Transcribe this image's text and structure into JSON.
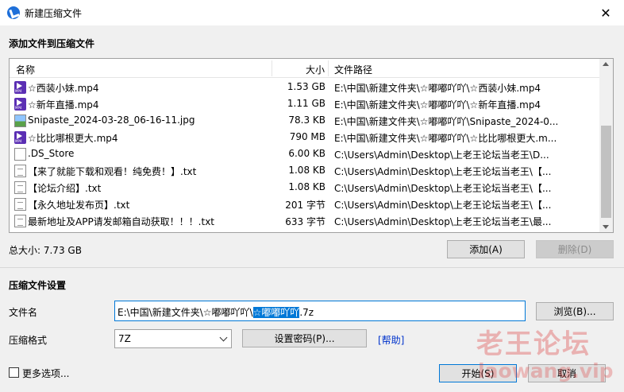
{
  "window": {
    "title": "新建压缩文件",
    "close": "✕"
  },
  "add_section": {
    "heading": "添加文件到压缩文件"
  },
  "file_list": {
    "columns": {
      "name": "名称",
      "size": "大小",
      "path": "文件路径"
    },
    "rows": [
      {
        "icon": "mp4-file-icon",
        "name": "☆西装小妹.mp4",
        "size": "1.53 GB",
        "path": "E:\\中国\\新建文件夹\\☆嘟嘟吖吖\\☆西装小妹.mp4"
      },
      {
        "icon": "mp4-file-icon",
        "name": "☆新年直播.mp4",
        "size": "1.11 GB",
        "path": "E:\\中国\\新建文件夹\\☆嘟嘟吖吖\\☆新年直播.mp4"
      },
      {
        "icon": "image-file-icon",
        "name": "Snipaste_2024-03-28_06-16-11.jpg",
        "size": "78.3 KB",
        "path": "E:\\中国\\新建文件夹\\☆嘟嘟吖吖\\Snipaste_2024-0..."
      },
      {
        "icon": "mp4-file-icon",
        "name": "☆比比哪根更大.mp4",
        "size": "790 MB",
        "path": "E:\\中国\\新建文件夹\\☆嘟嘟吖吖\\☆比比哪根更大.m..."
      },
      {
        "icon": "blank-file-icon",
        "name": ".DS_Store",
        "size": "6.00 KB",
        "path": "C:\\Users\\Admin\\Desktop\\上老王论坛当老王\\D..."
      },
      {
        "icon": "text-file-icon",
        "name": "【来了就能下载和观看！纯免费！】.txt",
        "size": "1.08 KB",
        "path": "C:\\Users\\Admin\\Desktop\\上老王论坛当老王\\【..."
      },
      {
        "icon": "text-file-icon",
        "name": "【论坛介绍】.txt",
        "size": "1.08 KB",
        "path": "C:\\Users\\Admin\\Desktop\\上老王论坛当老王\\【..."
      },
      {
        "icon": "text-file-icon",
        "name": "【永久地址发布页】.txt",
        "size": "201 字节",
        "path": "C:\\Users\\Admin\\Desktop\\上老王论坛当老王\\【..."
      },
      {
        "icon": "text-file-icon",
        "name": "最新地址及APP请发邮箱自动获取！！！.txt",
        "size": "633 字节",
        "path": "C:\\Users\\Admin\\Desktop\\上老王论坛当老王\\最..."
      }
    ]
  },
  "total": {
    "text": "总大小: 7.73 GB"
  },
  "buttons": {
    "add": "添加(A)",
    "delete": "删除(D)",
    "browse": "浏览(B)...",
    "set_password": "设置密码(P)...",
    "help": "[帮助]",
    "start": "开始(S)",
    "cancel": "取消"
  },
  "settings": {
    "heading": "压缩文件设置",
    "filename_label": "文件名",
    "filename_prefix": "E:\\中国\\新建文件夹\\☆嘟嘟吖吖\\",
    "filename_selected": "☆嘟嘟吖吖",
    "filename_suffix": ".7z",
    "format_label": "压缩格式",
    "format_value": "7Z"
  },
  "more_options": {
    "label": "更多选项..."
  },
  "watermark": {
    "line1": "老王论坛",
    "line2": "laowang.vip"
  },
  "colors": {
    "accent": "#0078d7",
    "mp4_icon": "#5b2fb4",
    "watermark": "#de3c3c"
  }
}
